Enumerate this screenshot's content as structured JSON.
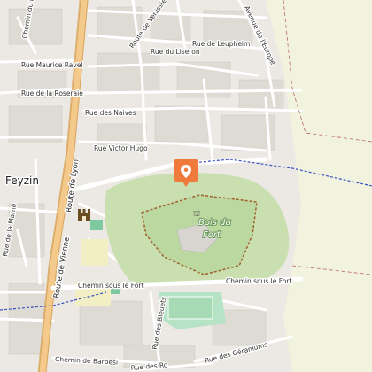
{
  "map": {
    "place": "Feyzin",
    "park_name_line1": "Bois du",
    "park_name_line2": "Fort",
    "streets": {
      "route_de_vienne": "Route de Vienne",
      "route_de_lyon": "Route de Lyon",
      "rue_maurice_ravel": "Rue Maurice Ravel",
      "rue_de_la_roseraie": "Rue de la Roseraie",
      "rue_des_naives": "Rue des Naives",
      "rue_victor_hugo": "Rue Victor Hugo",
      "chemin_du_mont": "Chemin du Mont",
      "route_de_venissieux": "Route de Vénissieux",
      "rue_de_leupheim": "Rue de Leupheim",
      "avenue_de_l_europe": "Avenue de l'Europe",
      "rue_du_liseron": "Rue du Liseron",
      "chemin_sous_le_fort_1": "Chemin sous le Fort",
      "chemin_sous_le_fort_2": "Chemin sous le Fort",
      "rue_des_bleuets": "Rue des Bleuets",
      "rue_des_geraniums": "Rue des Géraniums",
      "chemin_de_barbesi": "Chemin de Barbesi",
      "rue_de_la_marne": "Rue de la Marne",
      "rue_des_ro": "Rue des Ro"
    },
    "colors": {
      "background": "#ece9e4",
      "urban": "#e3e0db",
      "fields": "#f1f3df",
      "forest": "#c9dfb0",
      "park": "#d6ecc3",
      "main_road": "#f3c98c",
      "road_casing": "#d8a45a",
      "marker": "#f07a3c",
      "dashed_path": "#3a4fc0",
      "boundary": "#c06666"
    },
    "icons": {
      "marker": "map-pin-icon",
      "castle": "fort-icon"
    }
  }
}
